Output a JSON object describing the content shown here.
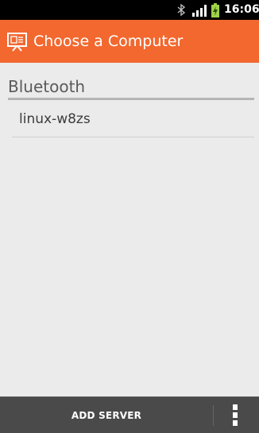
{
  "status_bar": {
    "time": "16:06",
    "icons": [
      "bluetooth-icon",
      "signal-icon",
      "battery-charging-icon"
    ]
  },
  "action_bar": {
    "icon": "presentation-screen-icon",
    "title": "Choose a Computer",
    "background_color": "#f2682f"
  },
  "list": {
    "section_header": "Bluetooth",
    "items": [
      {
        "label": "linux-w8zs"
      }
    ]
  },
  "bottom_bar": {
    "add_server_label": "ADD SERVER",
    "overflow_icon": "overflow-menu-icon"
  }
}
